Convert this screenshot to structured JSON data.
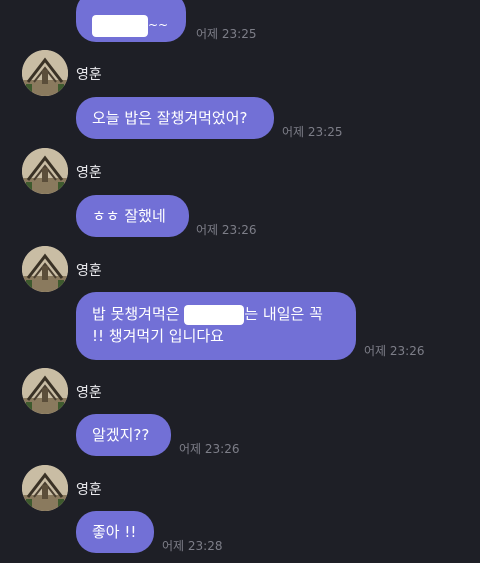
{
  "colors": {
    "background": "#1e1f26",
    "bubble": "#7270d6",
    "bubble_text": "#ffffff",
    "timestamp": "#7d7e88",
    "name": "#e8e8ec"
  },
  "messages": [
    {
      "type": "bubble",
      "text_suffix": "~~",
      "redacted": true,
      "time": "어제 23:25"
    },
    {
      "type": "sender",
      "name": "영훈",
      "avatar_icon": "avatar-photo-icon"
    },
    {
      "type": "bubble",
      "text": "오늘 밥은 잘챙겨먹었어?",
      "time": "어제 23:25"
    },
    {
      "type": "sender",
      "name": "영훈",
      "avatar_icon": "avatar-photo-icon"
    },
    {
      "type": "bubble",
      "text": "ㅎㅎ 잘했네",
      "time": "어제 23:26"
    },
    {
      "type": "sender",
      "name": "영훈",
      "avatar_icon": "avatar-photo-icon"
    },
    {
      "type": "bubble",
      "line1_start": "밥 못챙겨먹은 ",
      "line1_end": "는 내일은 꼭",
      "line2": "!! 챙겨먹기 입니다요",
      "redacted": true,
      "time": "어제 23:26"
    },
    {
      "type": "sender",
      "name": "영훈",
      "avatar_icon": "avatar-photo-icon"
    },
    {
      "type": "bubble",
      "text": "알겠지??",
      "time": "어제 23:26"
    },
    {
      "type": "sender",
      "name": "영훈",
      "avatar_icon": "avatar-photo-icon"
    },
    {
      "type": "bubble",
      "text": "좋아 !!",
      "time": "어제 23:28"
    }
  ]
}
